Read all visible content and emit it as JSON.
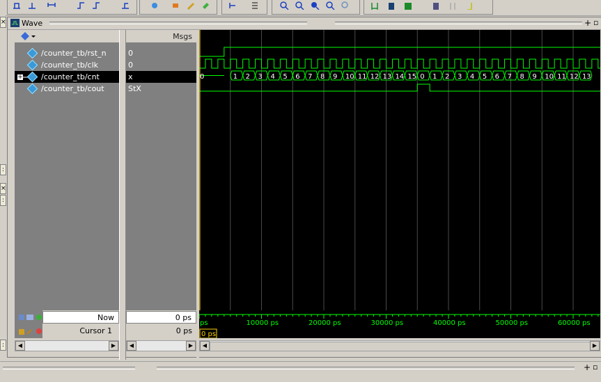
{
  "window": {
    "title": "Wave"
  },
  "header": {
    "msgs": "Msgs"
  },
  "signals": [
    {
      "name": "/counter_tb/rst_n",
      "value": "0",
      "expandable": false,
      "selected": false
    },
    {
      "name": "/counter_tb/clk",
      "value": "0",
      "expandable": false,
      "selected": false
    },
    {
      "name": "/counter_tb/cnt",
      "value": "x",
      "expandable": true,
      "selected": true
    },
    {
      "name": "/counter_tb/cout",
      "value": "StX",
      "expandable": false,
      "selected": false
    }
  ],
  "cnt_values": [
    "0",
    "1",
    "2",
    "3",
    "4",
    "5",
    "6",
    "7",
    "8",
    "9",
    "10",
    "11",
    "12",
    "13",
    "14",
    "15",
    "0",
    "1",
    "2",
    "3",
    "4",
    "5",
    "6",
    "7",
    "8",
    "9",
    "10",
    "11",
    "12",
    "13"
  ],
  "cursor_panel": {
    "now_label": "Now",
    "now_value": "0 ps",
    "cursor_label": "Cursor 1",
    "cursor_value": "0 ps",
    "cursor_marker": "0 ps"
  },
  "timeline": {
    "start_label": "ps",
    "ticks": [
      "10000 ps",
      "20000 ps",
      "30000 ps",
      "40000 ps",
      "50000 ps",
      "60000 ps"
    ]
  },
  "colors": {
    "wave": "#00ff00",
    "grid": "#4a4a4a",
    "cursor": "#ffd000",
    "selected_bg": "#000000"
  },
  "icons": {
    "toolbar": [
      "step-icon",
      "step-over-icon",
      "restart-icon",
      "run-icon",
      "run-continue-icon",
      "break-icon",
      "add-wave-icon",
      "insert-icon",
      "edit-icon",
      "find-icon",
      "zoom-in-icon",
      "zoom-out-icon",
      "zoom-full-icon",
      "zoom-cursor-icon",
      "zoom-last-icon",
      "cursor-add-icon",
      "cursor-delete-icon",
      "cursor-lock-icon",
      "format-icon"
    ]
  }
}
